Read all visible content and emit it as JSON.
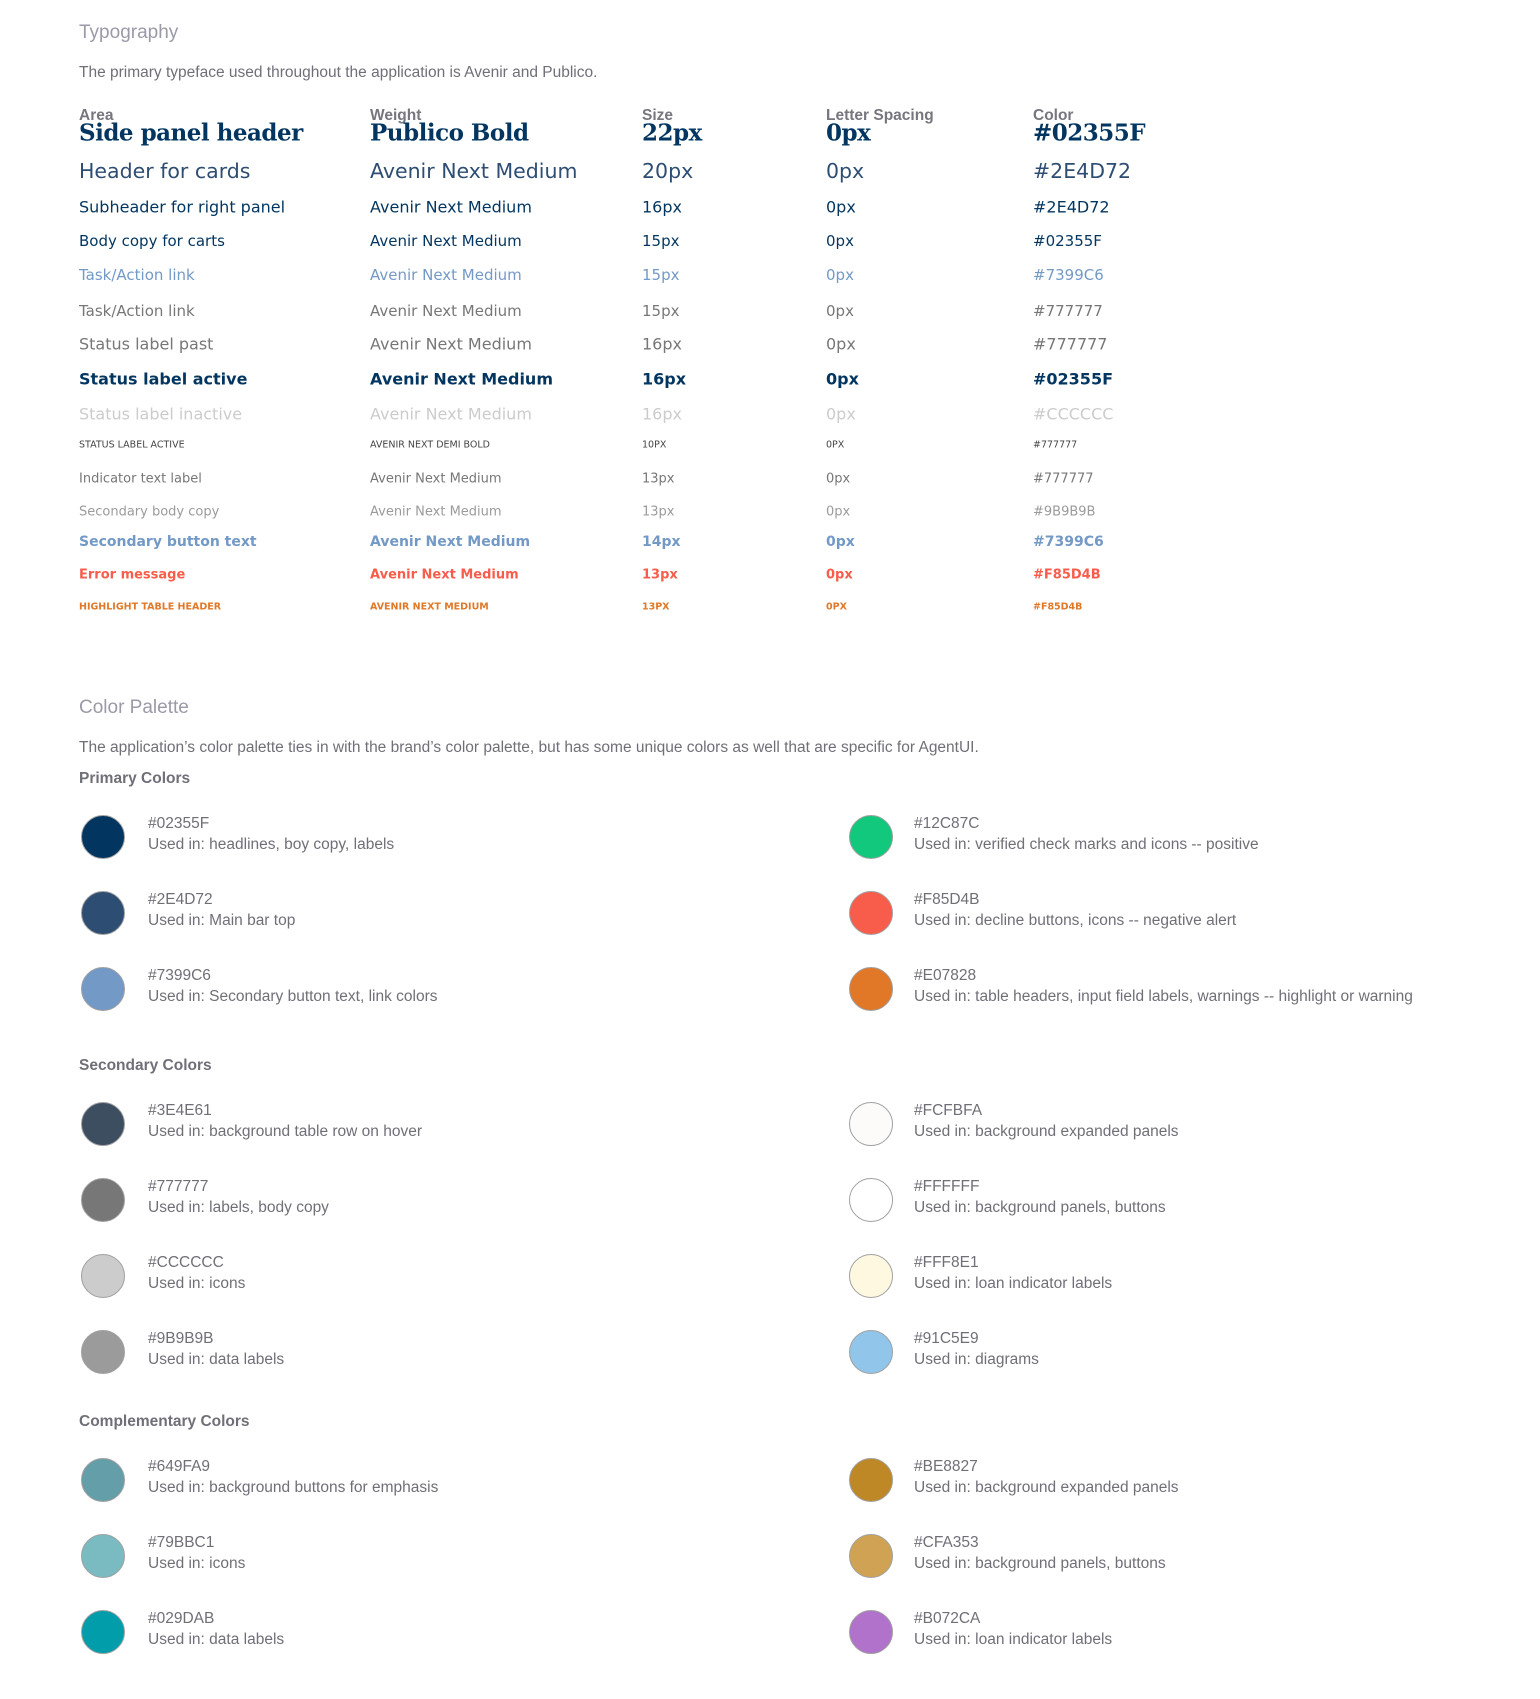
{
  "typography": {
    "title": "Typography",
    "intro": "The primary typeface used throughout the application is Avenir and Publico.",
    "columns": [
      "Area",
      "Weight",
      "Size",
      "Letter Spacing",
      "Color"
    ],
    "rows": [
      {
        "area": "Side panel header",
        "weight": "Publico Bold",
        "size": "22px",
        "letter_spacing": "0px",
        "color": "#02355F"
      },
      {
        "area": "Header for cards",
        "weight": "Avenir Next Medium",
        "size": "20px",
        "letter_spacing": "0px",
        "color": "#2E4D72"
      },
      {
        "area": "Subheader for right panel",
        "weight": "Avenir Next Medium",
        "size": "16px",
        "letter_spacing": "0px",
        "color": "#2E4D72"
      },
      {
        "area": "Body copy for carts",
        "weight": "Avenir Next Medium",
        "size": "15px",
        "letter_spacing": "0px",
        "color": "#02355F"
      },
      {
        "area": "Task/Action link",
        "weight": "Avenir Next Medium",
        "size": "15px",
        "letter_spacing": "0px",
        "color": "#7399C6"
      },
      {
        "area": "Task/Action link",
        "weight": "Avenir Next Medium",
        "size": "15px",
        "letter_spacing": "0px",
        "color": "#777777"
      },
      {
        "area": "Status label past",
        "weight": "Avenir Next Medium",
        "size": "16px",
        "letter_spacing": "0px",
        "color": "#777777"
      },
      {
        "area": "Status label active",
        "weight": "Avenir Next Medium",
        "size": "16px",
        "letter_spacing": "0px",
        "color": "#02355F"
      },
      {
        "area": "Status label inactive",
        "weight": "Avenir Next Medium",
        "size": "16px",
        "letter_spacing": "0px",
        "color": "#CCCCCC"
      },
      {
        "area": "STATUS LABEL ACTIVE",
        "weight": "AVENIR NEXT DEMI BOLD",
        "size": "10PX",
        "letter_spacing": "0PX",
        "color": "#777777"
      },
      {
        "area": "Indicator text label",
        "weight": "Avenir Next Medium",
        "size": "13px",
        "letter_spacing": "0px",
        "color": "#777777"
      },
      {
        "area": "Secondary body copy",
        "weight": "Avenir Next Medium",
        "size": "13px",
        "letter_spacing": "0px",
        "color": "#9B9B9B"
      },
      {
        "area": "Secondary button text",
        "weight": "Avenir Next Medium",
        "size": "14px",
        "letter_spacing": "0px",
        "color": "#7399C6"
      },
      {
        "area": "Error message",
        "weight": "Avenir Next Medium",
        "size": "13px",
        "letter_spacing": "0px",
        "color": "#F85D4B"
      },
      {
        "area": "HIGHLIGHT TABLE HEADER",
        "weight": "AVENIR  NEXT MEDIUM",
        "size": "13PX",
        "letter_spacing": "0PX",
        "color": "#F85D4B"
      }
    ]
  },
  "palette": {
    "title": "Color Palette",
    "intro": "The application’s color palette ties in with the brand’s color palette, but has some unique colors as well that are specific for AgentUI.",
    "groups": [
      {
        "title": "Primary Colors",
        "left": [
          {
            "hex": "#02355F",
            "usage": "Used in: headlines, boy copy, labels"
          },
          {
            "hex": "#2E4D72",
            "usage": "Used in: Main bar top"
          },
          {
            "hex": "#7399C6",
            "usage": "Used in: Secondary button text, link colors"
          }
        ],
        "right": [
          {
            "hex": "#12C87C",
            "usage": "Used in: verified check marks and icons -- positive"
          },
          {
            "hex": "#F85D4B",
            "usage": "Used in: decline buttons, icons -- negative alert"
          },
          {
            "hex": "#E07828",
            "usage": "Used in: table headers, input field labels, warnings -- highlight or warning"
          }
        ]
      },
      {
        "title": "Secondary Colors",
        "left": [
          {
            "hex": "#3E4E61",
            "usage": "Used in: background table row on hover"
          },
          {
            "hex": "#777777",
            "usage": "Used in: labels, body copy"
          },
          {
            "hex": "#CCCCCC",
            "usage": "Used in: icons"
          },
          {
            "hex": "#9B9B9B",
            "usage": "Used in: data labels"
          }
        ],
        "right": [
          {
            "hex": "#FCFBFA",
            "usage": "Used in: background expanded panels"
          },
          {
            "hex": "#FFFFFF",
            "usage": "Used in: background panels, buttons"
          },
          {
            "hex": "#FFF8E1",
            "usage": "Used in: loan indicator labels"
          },
          {
            "hex": "#91C5E9",
            "usage": "Used in: diagrams"
          }
        ]
      },
      {
        "title": "Complementary Colors",
        "left": [
          {
            "hex": "#649FA9",
            "usage": "Used in: background buttons for emphasis"
          },
          {
            "hex": "#79BBC1",
            "usage": "Used in: icons"
          },
          {
            "hex": "#029DAB",
            "usage": "Used in: data labels"
          }
        ],
        "right": [
          {
            "hex": "#BE8827",
            "usage": "Used in: background expanded panels"
          },
          {
            "hex": "#CFA353",
            "usage": "Used in: background panels, buttons"
          },
          {
            "hex": "#B072CA",
            "usage": "Used in: loan indicator labels"
          }
        ]
      }
    ]
  }
}
